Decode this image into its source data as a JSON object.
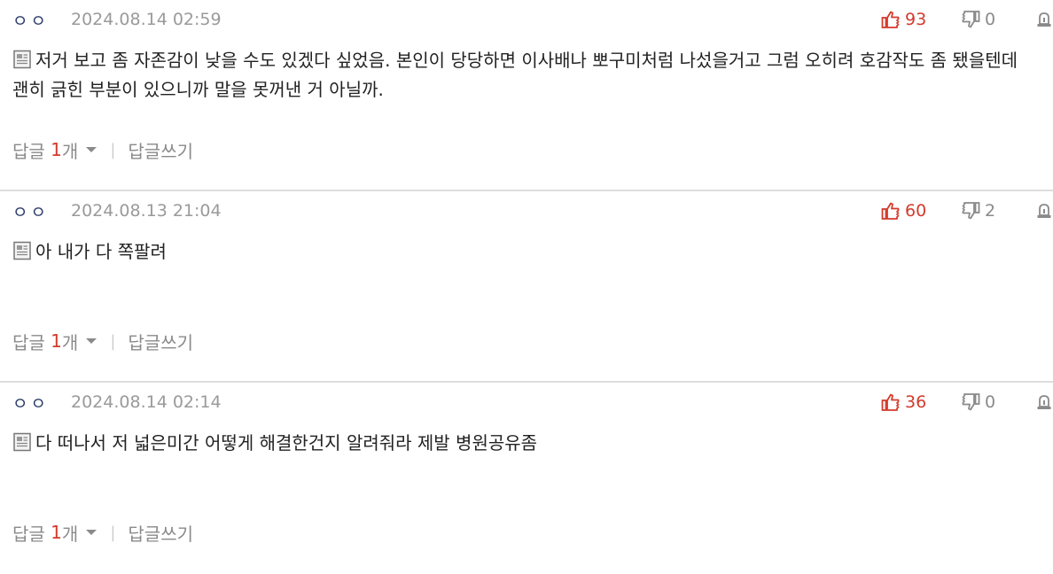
{
  "comments": [
    {
      "author": "ㅇㅇ",
      "date": "2024.08.14 02:59",
      "likes": "93",
      "dislikes": "0",
      "text": "저거 보고 좀 자존감이 낮을 수도 있겠다 싶었음. 본인이 당당하면 이사배나 뽀구미처럼 나섰을거고 그럼 오히려 호감작도 좀 됐을텐데 괜히 긁힌 부분이 있으니까 말을 못꺼낸 거 아닐까.",
      "reply_label": "답글",
      "reply_count": "1",
      "reply_unit": "개",
      "write_reply": "답글쓰기"
    },
    {
      "author": "ㅇㅇ",
      "date": "2024.08.13 21:04",
      "likes": "60",
      "dislikes": "2",
      "text": "아 내가 다 쪽팔려",
      "reply_label": "답글",
      "reply_count": "1",
      "reply_unit": "개",
      "write_reply": "답글쓰기"
    },
    {
      "author": "ㅇㅇ",
      "date": "2024.08.14 02:14",
      "likes": "36",
      "dislikes": "0",
      "text": "다 떠나서 저 넓은미간 어떻게 해결한건지 알려줘라 제발 병원공유좀",
      "reply_label": "답글",
      "reply_count": "1",
      "reply_unit": "개",
      "write_reply": "답글쓰기"
    }
  ],
  "icons": {
    "like": "thumbs-up-icon",
    "dislike": "thumbs-down-icon",
    "report": "report-siren-icon",
    "memo": "memo-icon",
    "caret": "chevron-down-icon"
  },
  "colors": {
    "like": "#d33a2c",
    "reply_count": "#d33a2c",
    "author": "#2c3e6a",
    "muted": "#8a8a8a",
    "divider": "#dddddd"
  }
}
